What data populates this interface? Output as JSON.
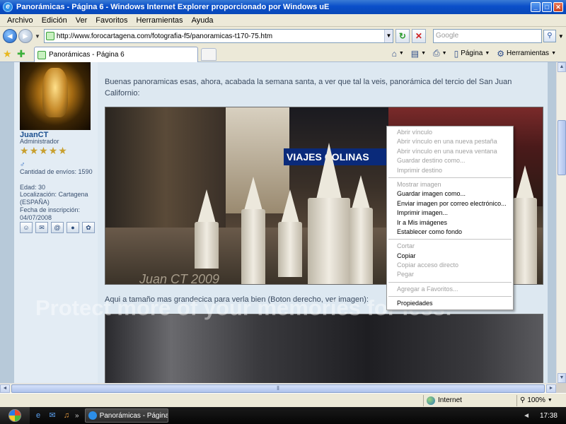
{
  "window": {
    "title": "Panorámicas - Página 6 - Windows Internet Explorer proporcionado por Windows uE",
    "controls": {
      "minimize": "_",
      "maximize": "□",
      "close": "✕"
    }
  },
  "menu": [
    "Archivo",
    "Edición",
    "Ver",
    "Favoritos",
    "Herramientas",
    "Ayuda"
  ],
  "address": {
    "url": "http://www.forocartagena.com/fotografia-f5/panoramicas-t170-75.htm",
    "search_placeholder": "Google"
  },
  "tab": {
    "title": "Panorámicas - Página 6"
  },
  "commandbar": {
    "page": "Página",
    "tools": "Herramientas"
  },
  "profile": {
    "name": "JuanCT",
    "rank": "Administrador",
    "stars": 5,
    "posts": "Cantidad de envíos: 1590",
    "age": "Edad: 30",
    "location": "Localización: Cartagena (ESPAÑA)",
    "joined": "Fecha de inscripción: 04/07/2008"
  },
  "post": {
    "text": "Buenas panoramicas esas, ahora, acabada la semana santa, a ver que tal la veis, panorámica del tercio del San Juan Californio:",
    "photo_sign": "VIAJES COLINAS",
    "photo_watermark": "Juan CT 2009",
    "text2": "Aqui a tamaño mas grandecica para verla bien (Boton derecho, ver imagen):",
    "overlay_watermark": "Protect more of your memories for less!"
  },
  "context_menu": [
    {
      "label": "Abrir vínculo",
      "disabled": true
    },
    {
      "label": "Abrir vínculo en una nueva pestaña",
      "disabled": true
    },
    {
      "label": "Abrir vínculo en una nueva ventana",
      "disabled": true
    },
    {
      "label": "Guardar destino como...",
      "disabled": true
    },
    {
      "label": "Imprimir destino",
      "disabled": true
    },
    {
      "separator": true
    },
    {
      "label": "Mostrar imagen",
      "disabled": true
    },
    {
      "label": "Guardar imagen como...",
      "disabled": false
    },
    {
      "label": "Enviar imagen por correo electrónico...",
      "disabled": false
    },
    {
      "label": "Imprimir imagen...",
      "disabled": false
    },
    {
      "label": "Ir a Mis imágenes",
      "disabled": false
    },
    {
      "label": "Establecer como fondo",
      "disabled": false
    },
    {
      "separator": true
    },
    {
      "label": "Cortar",
      "disabled": true
    },
    {
      "label": "Copiar",
      "disabled": false
    },
    {
      "label": "Copiar acceso directo",
      "disabled": true
    },
    {
      "label": "Pegar",
      "disabled": true
    },
    {
      "separator": true
    },
    {
      "label": "Agregar a Favoritos...",
      "disabled": true
    },
    {
      "separator": true
    },
    {
      "label": "Propiedades",
      "disabled": false
    }
  ],
  "status": {
    "zone": "Internet",
    "zoom": "100%"
  },
  "taskbar": {
    "task": "Panorámicas - Página...",
    "clock": "17:38"
  }
}
